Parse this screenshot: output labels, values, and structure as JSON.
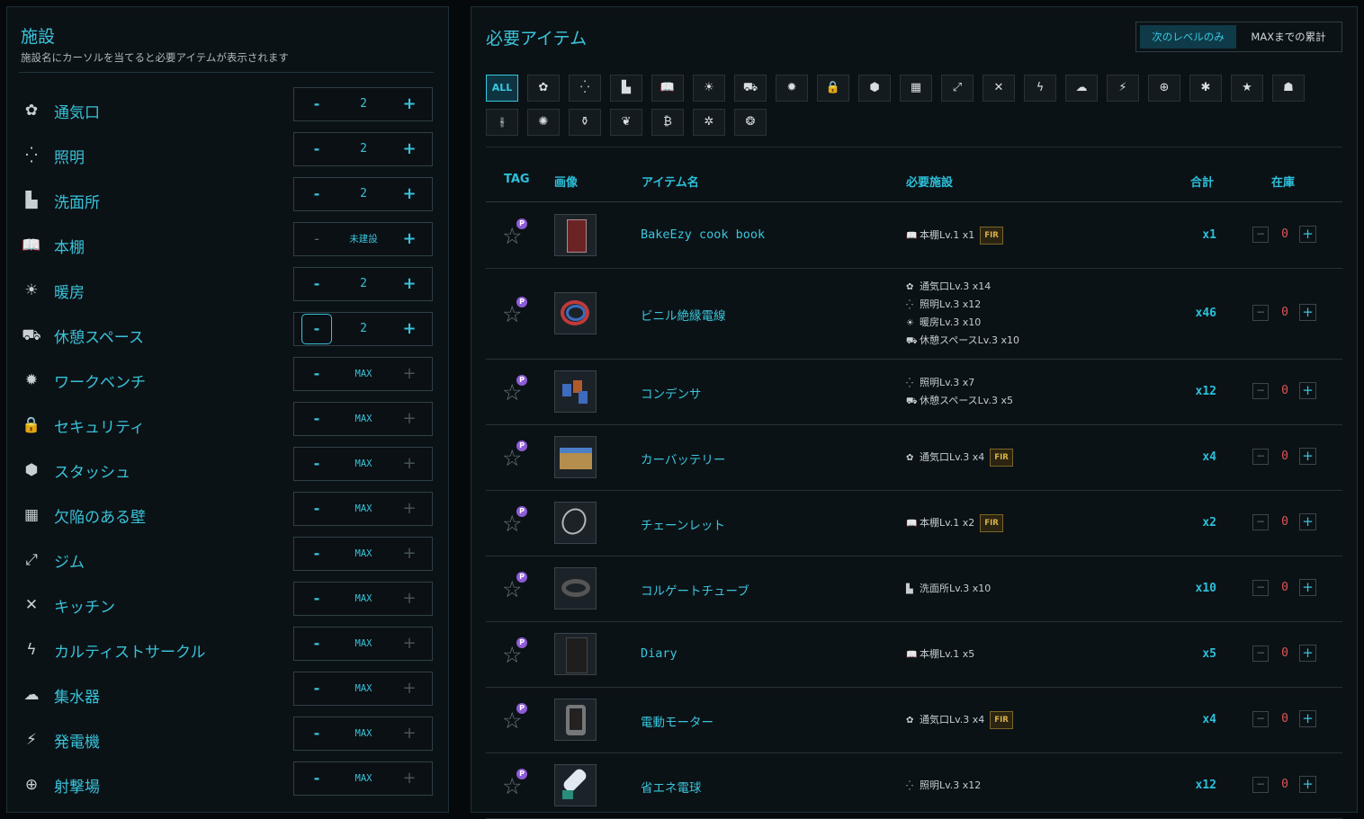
{
  "facilities_panel": {
    "title": "施設",
    "subtitle": "施設名にカーソルを当てると必要アイテムが表示されます",
    "rows": [
      {
        "name": "通気口",
        "value": "2",
        "icon": "vents-icon",
        "minus": "-",
        "plus": "+"
      },
      {
        "name": "照明",
        "value": "2",
        "icon": "illumination-icon",
        "minus": "-",
        "plus": "+"
      },
      {
        "name": "洗面所",
        "value": "2",
        "icon": "restroom-icon",
        "minus": "-",
        "plus": "+"
      },
      {
        "name": "本棚",
        "value": "未建設",
        "icon": "library-icon",
        "minus": "-",
        "plus": "+"
      },
      {
        "name": "暖房",
        "value": "2",
        "icon": "heating-icon",
        "minus": "-",
        "plus": "+"
      },
      {
        "name": "休憩スペース",
        "value": "2",
        "icon": "rest-space-icon",
        "minus": "-",
        "plus": "+"
      },
      {
        "name": "ワークベンチ",
        "value": "MAX",
        "icon": "workbench-icon",
        "minus": "-",
        "plus": "+"
      },
      {
        "name": "セキュリティ",
        "value": "MAX",
        "icon": "lock-icon",
        "minus": "-",
        "plus": "+"
      },
      {
        "name": "スタッシュ",
        "value": "MAX",
        "icon": "stash-box-icon",
        "minus": "-",
        "plus": "+"
      },
      {
        "name": "欠陥のある壁",
        "value": "MAX",
        "icon": "defective-wall-icon",
        "minus": "-",
        "plus": "+"
      },
      {
        "name": "ジム",
        "value": "MAX",
        "icon": "gym-dumbbell-icon",
        "minus": "-",
        "plus": "+"
      },
      {
        "name": "キッチン",
        "value": "MAX",
        "icon": "kitchen-utensils-icon",
        "minus": "-",
        "plus": "+"
      },
      {
        "name": "カルティストサークル",
        "value": "MAX",
        "icon": "cultist-circle-icon",
        "minus": "-",
        "plus": "+"
      },
      {
        "name": "集水器",
        "value": "MAX",
        "icon": "water-collector-icon",
        "minus": "-",
        "plus": "+"
      },
      {
        "name": "発電機",
        "value": "MAX",
        "icon": "generator-icon",
        "minus": "-",
        "plus": "+"
      },
      {
        "name": "射撃場",
        "value": "MAX",
        "icon": "shooting-range-icon",
        "minus": "-",
        "plus": "+"
      }
    ]
  },
  "items_panel": {
    "title": "必要アイテム",
    "mode_next": "次のレベルのみ",
    "mode_max": "MAXまでの累計",
    "filters": [
      {
        "label": "ALL",
        "icon": "all-filter"
      },
      {
        "label": "✿",
        "icon": "vents-filter-icon"
      },
      {
        "label": "⁛",
        "icon": "illumination-filter-icon"
      },
      {
        "label": "▙",
        "icon": "restroom-filter-icon"
      },
      {
        "label": "📖",
        "icon": "library-filter-icon"
      },
      {
        "label": "☀",
        "icon": "heating-filter-icon"
      },
      {
        "label": "⛟",
        "icon": "rest-space-filter-icon"
      },
      {
        "label": "✹",
        "icon": "workbench-filter-icon"
      },
      {
        "label": "🔒",
        "icon": "security-filter-icon"
      },
      {
        "label": "⬢",
        "icon": "stash-filter-icon"
      },
      {
        "label": "▦",
        "icon": "defective-wall-filter-icon"
      },
      {
        "label": "⤢",
        "icon": "gym-filter-icon"
      },
      {
        "label": "✕",
        "icon": "kitchen-filter-icon"
      },
      {
        "label": "ϟ",
        "icon": "cultist-circle-filter-icon"
      },
      {
        "label": "☁",
        "icon": "water-collector-filter-icon"
      },
      {
        "label": "⚡",
        "icon": "generator-filter-icon"
      },
      {
        "label": "⊕",
        "icon": "shooting-range-filter-icon"
      },
      {
        "label": "✱",
        "icon": "air-filtering-filter-icon"
      },
      {
        "label": "★",
        "icon": "hall-of-fame-filter-icon"
      },
      {
        "label": "☗",
        "icon": "intelligence-filter-icon"
      },
      {
        "label": "⫳",
        "icon": "medstation-filter-icon"
      },
      {
        "label": "✺",
        "icon": "nutrition-filter-icon"
      },
      {
        "label": "⚱",
        "icon": "booze-generator-filter-icon"
      },
      {
        "label": "❦",
        "icon": "scav-case-filter-icon"
      },
      {
        "label": "₿",
        "icon": "bitcoin-farm-filter-icon"
      },
      {
        "label": "✲",
        "icon": "solar-power-filter-icon"
      },
      {
        "label": "❂",
        "icon": "weapon-rack-filter-icon"
      }
    ],
    "headers": {
      "tag": "TAG",
      "image": "画像",
      "name": "アイテム名",
      "required": "必要施設",
      "total": "合計",
      "stock": "在庫"
    },
    "items": [
      {
        "name": "BakeEzy cook book",
        "total": "x1",
        "stock": "0",
        "req": [
          {
            "icon": "📖",
            "text": "本棚Lv.1 x1",
            "fir": "FIR"
          }
        ]
      },
      {
        "name": "ビニル絶縁電線",
        "total": "x46",
        "stock": "0",
        "req": [
          {
            "icon": "✿",
            "text": "通気口Lv.3 x14"
          },
          {
            "icon": "⁛",
            "text": "照明Lv.3 x12"
          },
          {
            "icon": "☀",
            "text": "暖房Lv.3 x10"
          },
          {
            "icon": "⛟",
            "text": "休憩スペースLv.3 x10"
          }
        ]
      },
      {
        "name": "コンデンサ",
        "total": "x12",
        "stock": "0",
        "req": [
          {
            "icon": "⁛",
            "text": "照明Lv.3 x7"
          },
          {
            "icon": "⛟",
            "text": "休憩スペースLv.3 x5"
          }
        ]
      },
      {
        "name": "カーバッテリー",
        "total": "x4",
        "stock": "0",
        "req": [
          {
            "icon": "✿",
            "text": "通気口Lv.3 x4",
            "fir": "FIR"
          }
        ]
      },
      {
        "name": "チェーンレット",
        "total": "x2",
        "stock": "0",
        "req": [
          {
            "icon": "📖",
            "text": "本棚Lv.1 x2",
            "fir": "FIR"
          }
        ]
      },
      {
        "name": "コルゲートチューブ",
        "total": "x10",
        "stock": "0",
        "req": [
          {
            "icon": "▙",
            "text": "洗面所Lv.3 x10"
          }
        ]
      },
      {
        "name": "Diary",
        "total": "x5",
        "stock": "0",
        "req": [
          {
            "icon": "📖",
            "text": "本棚Lv.1 x5"
          }
        ]
      },
      {
        "name": "電動モーター",
        "total": "x4",
        "stock": "0",
        "req": [
          {
            "icon": "✿",
            "text": "通気口Lv.3 x4",
            "fir": "FIR"
          }
        ]
      },
      {
        "name": "省エネ電球",
        "total": "x12",
        "stock": "0",
        "req": [
          {
            "icon": "⁛",
            "text": "照明Lv.3 x12"
          }
        ]
      }
    ],
    "tag_badge": "P",
    "stock_minus": "−",
    "stock_plus": "+"
  },
  "colors": {
    "accent": "#39c2d9",
    "stock_zero": "#e05454",
    "fir_gold": "#d7b24a",
    "badge_purple": "#8e5bd7"
  }
}
